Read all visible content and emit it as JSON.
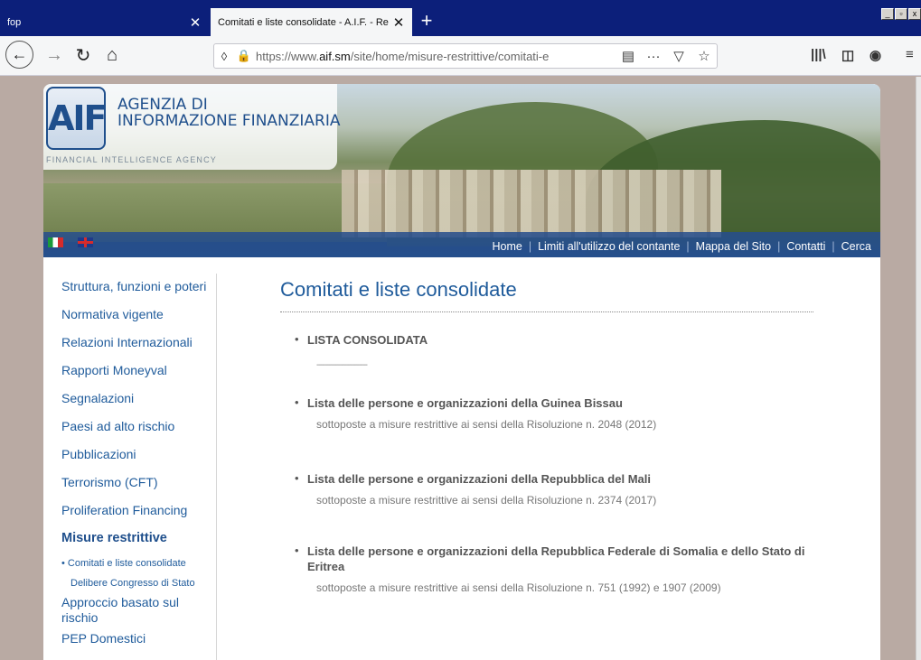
{
  "browser": {
    "tabs": [
      {
        "title": "fop",
        "close": "✕"
      },
      {
        "title": "Comitati e liste consolidate - A.I.F. - Re",
        "close": "✕"
      }
    ],
    "new_tab": "+",
    "url_prefix": "https://www.",
    "url_domain": "aif.sm",
    "url_rest": "/site/home/misure-restrittive/comitati-e"
  },
  "site": {
    "logo_mark": "AIF",
    "logo_line1": "AGENZIA DI",
    "logo_line2": "INFORMAZIONE FINANZIARIA",
    "logo_sub": "FINANCIAL INTELLIGENCE AGENCY",
    "topnav": [
      "Home",
      "Limiti all'utilizzo del contante",
      "Mappa del Sito",
      "Contatti",
      "Cerca"
    ]
  },
  "sidenav": {
    "items": [
      "Struttura, funzioni e poteri",
      "Normativa vigente",
      "Relazioni Internazionali",
      "Rapporti Moneyval",
      "Segnalazioni",
      "Paesi ad alto rischio",
      "Pubblicazioni",
      "Terrorismo (CFT)",
      "Proliferation Financing"
    ],
    "active": "Misure restrittive",
    "subitems": [
      "Comitati e liste consolidate",
      "Delibere Congresso di Stato"
    ],
    "after": [
      "Approccio basato sul rischio",
      "PEP Domestici"
    ]
  },
  "main": {
    "title": "Comitati e liste consolidate",
    "entries": [
      {
        "head": "LISTA CONSOLIDATA",
        "dash": "------------------------"
      },
      {
        "head": "Lista delle persone e organizzazioni della Guinea Bissau",
        "desc": "sottoposte a misure restrittive ai sensi della Risoluzione n. 2048 (2012)"
      },
      {
        "head": "Lista delle persone e organizzazioni della Repubblica del Mali",
        "desc": "sottoposte a misure restrittive ai sensi della Risoluzione n. 2374 (2017)"
      },
      {
        "head": "Lista delle persone e organizzazioni della Repubblica Federale di Somalia e dello Stato di Eritrea",
        "desc": "sottoposte a misure restrittive ai sensi della Risoluzione n. 751 (1992) e 1907 (2009)"
      }
    ]
  }
}
